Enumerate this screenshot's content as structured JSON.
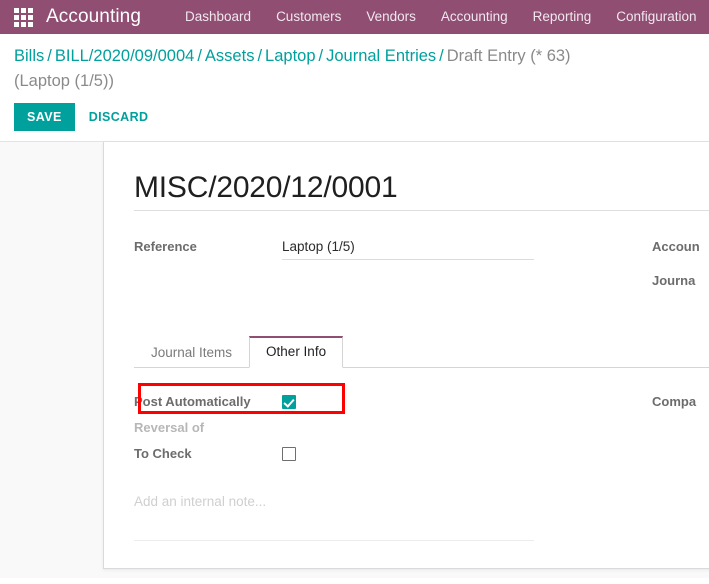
{
  "navbar": {
    "apps_icon": "apps-grid-icon",
    "brand": "Accounting",
    "menu": [
      {
        "label": "Dashboard"
      },
      {
        "label": "Customers"
      },
      {
        "label": "Vendors"
      },
      {
        "label": "Accounting"
      },
      {
        "label": "Reporting"
      },
      {
        "label": "Configuration"
      }
    ],
    "bg_color": "#8f4e72"
  },
  "breadcrumb": {
    "items": [
      {
        "label": "Bills",
        "link": true
      },
      {
        "label": "BILL/2020/09/0004",
        "link": true
      },
      {
        "label": "Assets",
        "link": true
      },
      {
        "label": "Laptop",
        "link": true
      },
      {
        "label": "Journal Entries",
        "link": true
      },
      {
        "label": "Draft Entry (* 63) (Laptop (1/5))",
        "link": false
      }
    ],
    "separator": "/"
  },
  "actions": {
    "save_label": "SAVE",
    "discard_label": "DISCARD",
    "save_color": "#00a09d",
    "discard_color": "#00a09d"
  },
  "form": {
    "title": "MISC/2020/12/0001",
    "left_fields": [
      {
        "label": "Reference",
        "value": "Laptop (1/5)"
      }
    ],
    "right_fields": [
      {
        "label": "Accoun",
        "value": ""
      },
      {
        "label": "Journa",
        "value": ""
      }
    ]
  },
  "notebook": {
    "tabs": [
      {
        "label": "Journal Items",
        "active": false
      },
      {
        "label": "Other Info",
        "active": true
      }
    ],
    "active_tab_color": "#8f4e72"
  },
  "other_info": {
    "left_rows": [
      {
        "label": "Post Automatically",
        "type": "checkbox",
        "checked": true,
        "highlighted": true
      },
      {
        "label": "Reversal of",
        "type": "readonly",
        "value": "",
        "muted": true
      },
      {
        "label": "To Check",
        "type": "checkbox",
        "checked": false,
        "highlighted": false
      }
    ],
    "right_rows": [
      {
        "label": "Compa",
        "type": "text",
        "value": ""
      }
    ],
    "note_placeholder": "Add an internal note..."
  },
  "annotation": {
    "border_color": "#fd0000",
    "target": "Post Automatically"
  }
}
